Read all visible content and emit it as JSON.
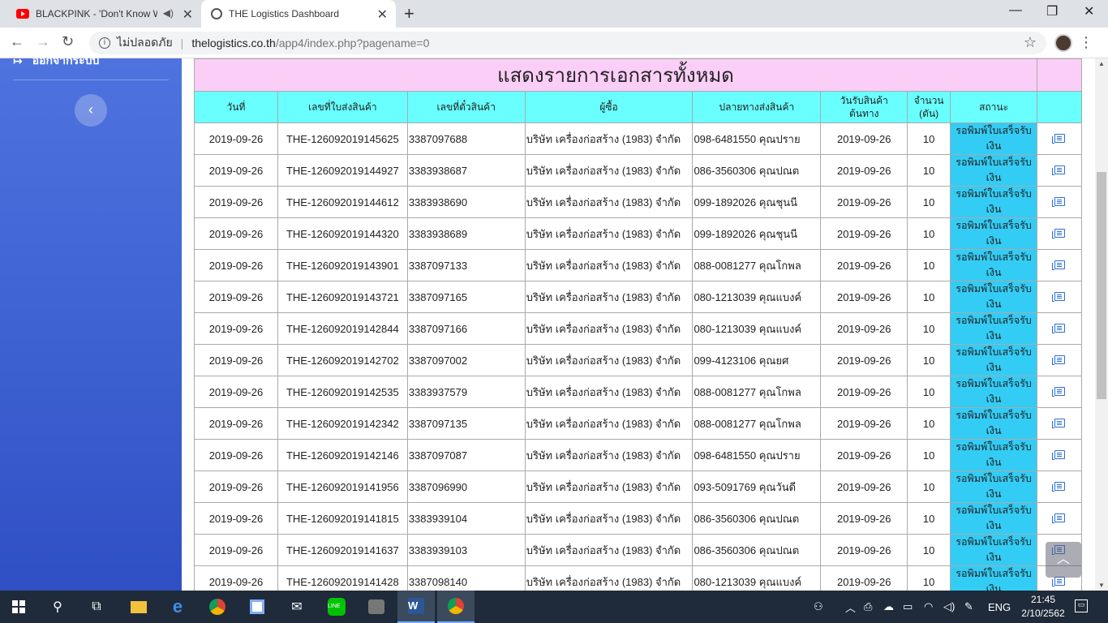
{
  "browser": {
    "tabs": [
      {
        "label": "BLACKPINK - 'Don't Know W",
        "icon": "youtube-icon"
      },
      {
        "label": "THE Logistics Dashboard",
        "icon": "globe-icon"
      }
    ],
    "security_label": "ไม่ปลอดภัย",
    "url_host": "thelogistics.co.th",
    "url_path": "/app4/index.php?pagename=0"
  },
  "sidebar": {
    "logout_label": "ออกจากระบบ",
    "toggle_icon": "chevron-left-icon"
  },
  "table": {
    "title": "แสดงรายการเอกสารทั้งหมด",
    "headers": {
      "date": "วันที่",
      "invoice": "เลขที่ใบส่งสินค้า",
      "ticket": "เลขที่ตั๋วสินค้า",
      "buyer": "ผู้ซื้อ",
      "destination": "ปลายทางส่งสินค้า",
      "pickup_1": "วันรับสินค้า",
      "pickup_2": "ต้นทาง",
      "qty_1": "จำนวน",
      "qty_2": "(ตัน)",
      "status": "สถานะ"
    },
    "rows": [
      {
        "date": "2019-09-26",
        "invoice": "THE-126092019145625",
        "ticket": "3387097688",
        "buyer": "บริษัท เครื่องก่อสร้าง (1983) จำกัด",
        "destination": "098-6481550 คุณปราย",
        "pickup": "2019-09-26",
        "qty": "10",
        "status": "รอพิมพ์ใบเสร็จรับเงิน"
      },
      {
        "date": "2019-09-26",
        "invoice": "THE-126092019144927",
        "ticket": "3383938687",
        "buyer": "บริษัท เครื่องก่อสร้าง (1983) จำกัด",
        "destination": "086-3560306 คุณปณต",
        "pickup": "2019-09-26",
        "qty": "10",
        "status": "รอพิมพ์ใบเสร็จรับเงิน"
      },
      {
        "date": "2019-09-26",
        "invoice": "THE-126092019144612",
        "ticket": "3383938690",
        "buyer": "บริษัท เครื่องก่อสร้าง (1983) จำกัด",
        "destination": "099-1892026 คุณชุนนี",
        "pickup": "2019-09-26",
        "qty": "10",
        "status": "รอพิมพ์ใบเสร็จรับเงิน"
      },
      {
        "date": "2019-09-26",
        "invoice": "THE-126092019144320",
        "ticket": "3383938689",
        "buyer": "บริษัท เครื่องก่อสร้าง (1983) จำกัด",
        "destination": "099-1892026 คุณชุนนี",
        "pickup": "2019-09-26",
        "qty": "10",
        "status": "รอพิมพ์ใบเสร็จรับเงิน"
      },
      {
        "date": "2019-09-26",
        "invoice": "THE-126092019143901",
        "ticket": "3387097133",
        "buyer": "บริษัท เครื่องก่อสร้าง (1983) จำกัด",
        "destination": "088-0081277 คุณโกพล",
        "pickup": "2019-09-26",
        "qty": "10",
        "status": "รอพิมพ์ใบเสร็จรับเงิน"
      },
      {
        "date": "2019-09-26",
        "invoice": "THE-126092019143721",
        "ticket": "3387097165",
        "buyer": "บริษัท เครื่องก่อสร้าง (1983) จำกัด",
        "destination": "080-1213039 คุณแบงค์",
        "pickup": "2019-09-26",
        "qty": "10",
        "status": "รอพิมพ์ใบเสร็จรับเงิน"
      },
      {
        "date": "2019-09-26",
        "invoice": "THE-126092019142844",
        "ticket": "3387097166",
        "buyer": "บริษัท เครื่องก่อสร้าง (1983) จำกัด",
        "destination": "080-1213039 คุณแบงค์",
        "pickup": "2019-09-26",
        "qty": "10",
        "status": "รอพิมพ์ใบเสร็จรับเงิน"
      },
      {
        "date": "2019-09-26",
        "invoice": "THE-126092019142702",
        "ticket": "3387097002",
        "buyer": "บริษัท เครื่องก่อสร้าง (1983) จำกัด",
        "destination": "099-4123106 คุณยศ",
        "pickup": "2019-09-26",
        "qty": "10",
        "status": "รอพิมพ์ใบเสร็จรับเงิน"
      },
      {
        "date": "2019-09-26",
        "invoice": "THE-126092019142535",
        "ticket": "3383937579",
        "buyer": "บริษัท เครื่องก่อสร้าง (1983) จำกัด",
        "destination": "088-0081277 คุณโกพล",
        "pickup": "2019-09-26",
        "qty": "10",
        "status": "รอพิมพ์ใบเสร็จรับเงิน"
      },
      {
        "date": "2019-09-26",
        "invoice": "THE-126092019142342",
        "ticket": "3387097135",
        "buyer": "บริษัท เครื่องก่อสร้าง (1983) จำกัด",
        "destination": "088-0081277 คุณโกพล",
        "pickup": "2019-09-26",
        "qty": "10",
        "status": "รอพิมพ์ใบเสร็จรับเงิน"
      },
      {
        "date": "2019-09-26",
        "invoice": "THE-126092019142146",
        "ticket": "3387097087",
        "buyer": "บริษัท เครื่องก่อสร้าง (1983) จำกัด",
        "destination": "098-6481550 คุณปราย",
        "pickup": "2019-09-26",
        "qty": "10",
        "status": "รอพิมพ์ใบเสร็จรับเงิน"
      },
      {
        "date": "2019-09-26",
        "invoice": "THE-126092019141956",
        "ticket": "3387096990",
        "buyer": "บริษัท เครื่องก่อสร้าง (1983) จำกัด",
        "destination": "093-5091769 คุณวันดี",
        "pickup": "2019-09-26",
        "qty": "10",
        "status": "รอพิมพ์ใบเสร็จรับเงิน"
      },
      {
        "date": "2019-09-26",
        "invoice": "THE-126092019141815",
        "ticket": "3383939104",
        "buyer": "บริษัท เครื่องก่อสร้าง (1983) จำกัด",
        "destination": "086-3560306 คุณปณต",
        "pickup": "2019-09-26",
        "qty": "10",
        "status": "รอพิมพ์ใบเสร็จรับเงิน"
      },
      {
        "date": "2019-09-26",
        "invoice": "THE-126092019141637",
        "ticket": "3383939103",
        "buyer": "บริษัท เครื่องก่อสร้าง (1983) จำกัด",
        "destination": "086-3560306 คุณปณต",
        "pickup": "2019-09-26",
        "qty": "10",
        "status": "รอพิมพ์ใบเสร็จรับเงิน"
      },
      {
        "date": "2019-09-26",
        "invoice": "THE-126092019141428",
        "ticket": "3387098140",
        "buyer": "บริษัท เครื่องก่อสร้าง (1983) จำกัด",
        "destination": "080-1213039 คุณแบงค์",
        "pickup": "2019-09-26",
        "qty": "10",
        "status": "รอพิมพ์ใบเสร็จรับเงิน"
      }
    ]
  },
  "taskbar": {
    "language": "ENG",
    "time": "21:45",
    "date": "2/10/2562"
  }
}
